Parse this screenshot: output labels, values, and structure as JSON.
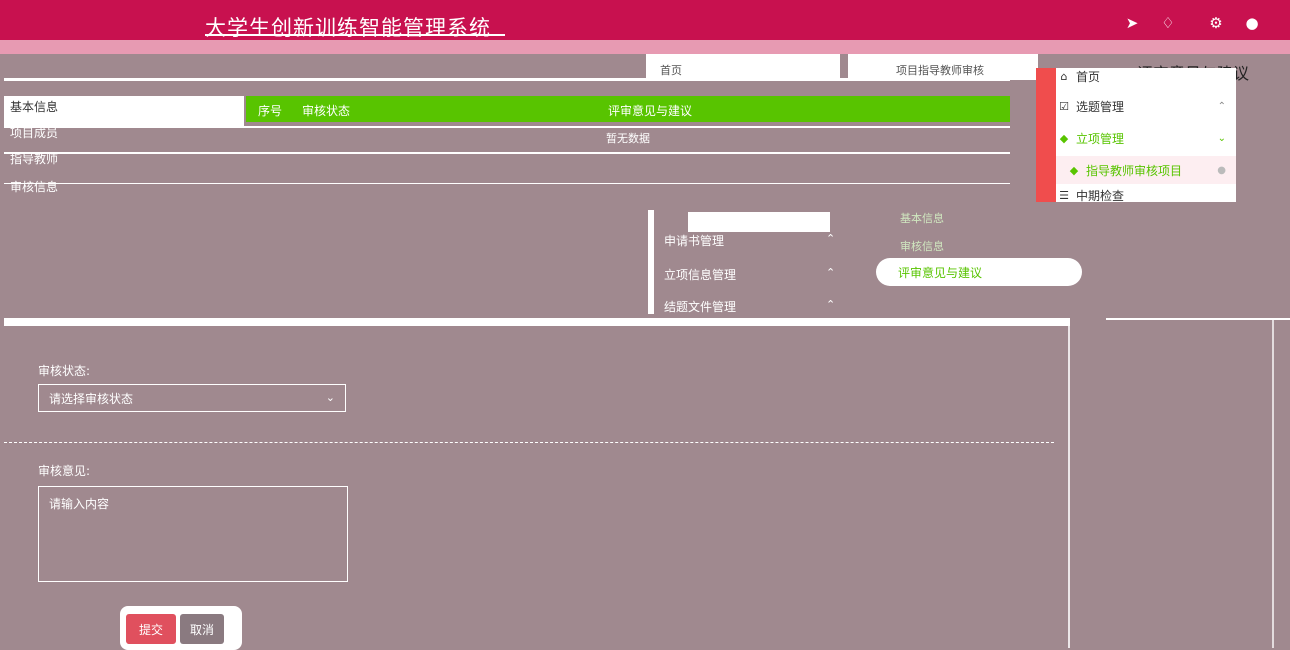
{
  "header": {
    "title": "大学生创新训练智能管理系统"
  },
  "crumbs": {
    "home": "首页",
    "path": "项目指导教师审核"
  },
  "page": {
    "heading": "评审意见与建议"
  },
  "left_labels": [
    "基本信息",
    "项目成员",
    "指导教师",
    "审核信息"
  ],
  "table": {
    "columns": [
      "序号",
      "审核状态",
      "评审意见与建议"
    ],
    "empty_text": "暂无数据"
  },
  "menu": {
    "items": [
      {
        "label": "首页"
      },
      {
        "label": "选题管理"
      },
      {
        "label": "立项管理"
      },
      {
        "label": "指导教师审核项目"
      },
      {
        "label": "中期检查"
      }
    ]
  },
  "mid": {
    "items": [
      "申请书管理",
      "立项信息管理",
      "结题文件管理"
    ]
  },
  "tabs": {
    "items": [
      "基本信息",
      "审核信息",
      "评审意见与建议"
    ]
  },
  "form": {
    "status_label": "审核状态:",
    "status_placeholder": "请选择审核状态",
    "opinion_label": "审核意见:",
    "opinion_placeholder": "请输入内容",
    "submit": "提交",
    "cancel": "取消"
  },
  "colors": {
    "header": "#c8114f",
    "accent_green": "#58c400",
    "danger": "#e0505e"
  }
}
